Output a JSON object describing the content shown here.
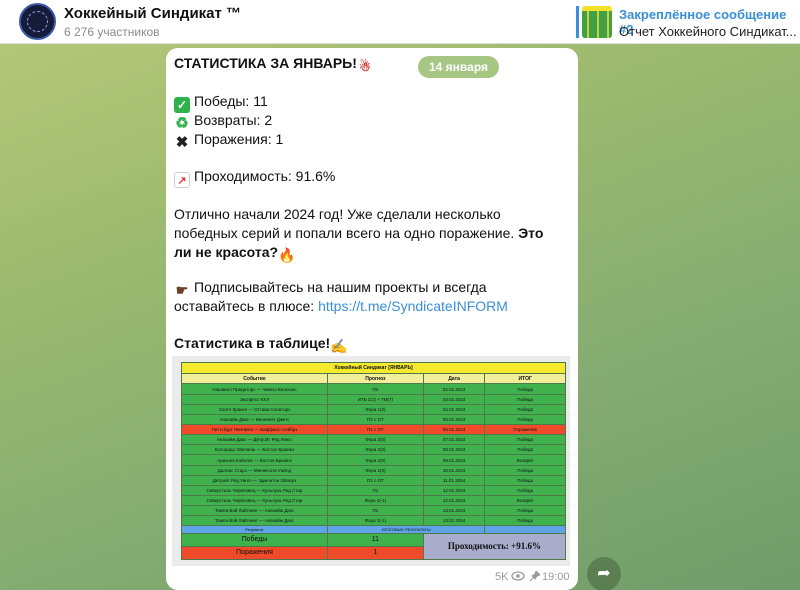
{
  "channel": {
    "title": "Хоккейный Синдикат ™",
    "subscribers": "6 276 участников"
  },
  "pinned": {
    "label": "Закреплённое сообщение #2",
    "text": "Отчет Хоккейного Синдикат..."
  },
  "date": "14 января",
  "post": {
    "headline": "СТАТИСТИКА ЗА ЯНВАРЬ!",
    "wins": "Победы: 11",
    "returns": "Возвраты: 2",
    "losses": "Поражения: 1",
    "passability": "Проходимость: 91.6%",
    "para1_line1": "Отлично начали 2024 год! Уже сделали несколько",
    "para1_line2_normal": "победных серий и попали всего на одно поражение.",
    "para1_line2_bold": " Это",
    "para1_line3_bold": "ли не красота?",
    "sub_line1": "Подписывайтесь на нашим проекты и всегда",
    "sub_line2": "оставайтесь в плюсе:",
    "sub_link": "https://t.me/SyndicateINFORM",
    "table_caption": "Статистика в таблице!"
  },
  "table": {
    "title": "Хоккейный Синдикат [ЯНВАРЬ]",
    "headers": [
      "Событие",
      "Прогноз",
      "Дата",
      "ИТОГ"
    ],
    "rows": [
      [
        "Нашвилл Предаторс — Чикаго Блэкхокс",
        "П1",
        "02.01.2024",
        "Победа"
      ],
      [
        "Экспресс КХЛ",
        "ИТБ 2(1) + ТМ(7)",
        "03.01.2024",
        "Победа"
      ],
      [
        "Сиэтл Кракен — Оттава Сенаторз",
        "Фора 1(0)",
        "04.01.2024",
        "Победа"
      ],
      [
        "Анахайм Дакс — Виннипег Джетс",
        "П2 с ОТ",
        "05.01.2024",
        "Победа"
      ],
      [
        "Питтсбург Пингвинз — Баффало Сейбрз",
        "П1 с ОТ",
        "06.01.2024",
        "Поражение"
      ],
      [
        "Анахайм Дакс — Детройт Ред Уингз",
        "Фора 2(0)",
        "07.01.2024",
        "Победа"
      ],
      [
        "Колорадо Эвеланш — Бостон Брюинз",
        "Фора 2(0)",
        "08.01.2024",
        "Победа"
      ],
      [
        "Аризона Койотис — Бостон Брюинз",
        "Фора 2(0)",
        "09.01.2024",
        "Возврат"
      ],
      [
        "Даллас Старз — Миннесота Уайлд",
        "Фора 1(0)",
        "10.01.2024",
        "Победа"
      ],
      [
        "Детройт Ред Уингз — Эдмонтон Ойлерз",
        "П2 с ОТ",
        "11.01.2024",
        "Победа"
      ],
      [
        "Северсталь Череповец — Куньлунь Ред Стар",
        "П1",
        "12.01.2024",
        "Победа"
      ],
      [
        "Северсталь Череповец — Куньлунь Ред Стар",
        "Фора 1(-1)",
        "12.01.2024",
        "Возврат"
      ],
      [
        "Тампа-Бэй Лайтнинг — Анахайм Дакс",
        "П1",
        "13.01.2024",
        "Победа"
      ],
      [
        "Тампа-Бэй Лайтнинг — Анахайм Дакс",
        "Фора 1(-1)",
        "13.01.2024",
        "Победа"
      ]
    ],
    "result_row": [
      "Результат",
      "ИТОГОВЫЕ РЕЗУЛЬТАТЫ"
    ],
    "foot_wins_label": "Победы",
    "foot_wins_value": "11",
    "foot_losses_label": "Поражения",
    "foot_losses_value": "1",
    "foot_pass": "Проходимость: +91.6%"
  },
  "meta": {
    "views": "5K",
    "time": "19:00"
  },
  "icons": {
    "check": "check-square-icon",
    "recycle": "recycle-icon",
    "cross": "cross-icon",
    "chart": "chart-up-icon",
    "hand": "pointing-hand-icon",
    "fire": "fire-icon",
    "santa": "santa-icon",
    "write": "writing-hand-icon",
    "eye": "eye-icon",
    "pin": "pin-icon",
    "forward": "forward-arrow-icon"
  },
  "colors": {
    "accent": "#3a8fd6",
    "win": "#3fb24e",
    "loss": "#ef4b2a",
    "header_yellow": "#f6ea2e"
  }
}
